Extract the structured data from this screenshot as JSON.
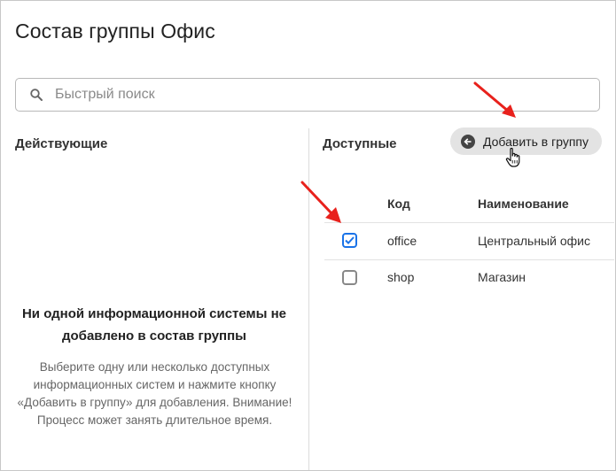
{
  "page": {
    "title": "Состав группы Офис"
  },
  "search": {
    "placeholder": "Быстрый поиск"
  },
  "active": {
    "title": "Действующие",
    "empty_title": "Ни одной информационной системы не добавлено в состав группы",
    "empty_description": "Выберите одну или несколько доступных информационных систем и нажмите кнопку «Добавить в группу» для добавления. Внимание! Процесс может занять длительное время."
  },
  "available": {
    "title": "Доступные",
    "add_button_label": "Добавить в группу",
    "columns": {
      "code": "Код",
      "name": "Наименование"
    },
    "rows": [
      {
        "code": "office",
        "name": "Центральный офис",
        "checked": true
      },
      {
        "code": "shop",
        "name": "Магазин",
        "checked": false
      }
    ]
  },
  "colors": {
    "accent": "#1a73e8",
    "annotation_arrow": "#e8211c"
  }
}
